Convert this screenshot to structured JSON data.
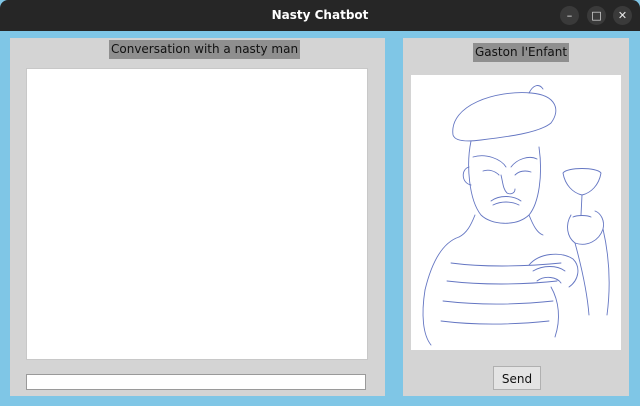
{
  "window": {
    "title": "Nasty Chatbot"
  },
  "window_controls": {
    "minimize_icon": "minimize-icon",
    "maximize_icon": "maximize-icon",
    "close_icon": "close-icon",
    "minimize_glyph": "–",
    "maximize_glyph": "□",
    "close_glyph": "✕"
  },
  "chat": {
    "heading": "Conversation with a nasty man",
    "transcript": "",
    "input_value": ""
  },
  "character": {
    "name": "Gaston l'Enfant",
    "portrait": "line-drawing-portrait"
  },
  "actions": {
    "send_label": "Send"
  },
  "colors": {
    "window_bg": "#7fc6e6",
    "titlebar": "#262626",
    "panel": "#d4d4d4",
    "label_bg": "#8f8f8f",
    "sketch_line": "#4a5fb8"
  }
}
